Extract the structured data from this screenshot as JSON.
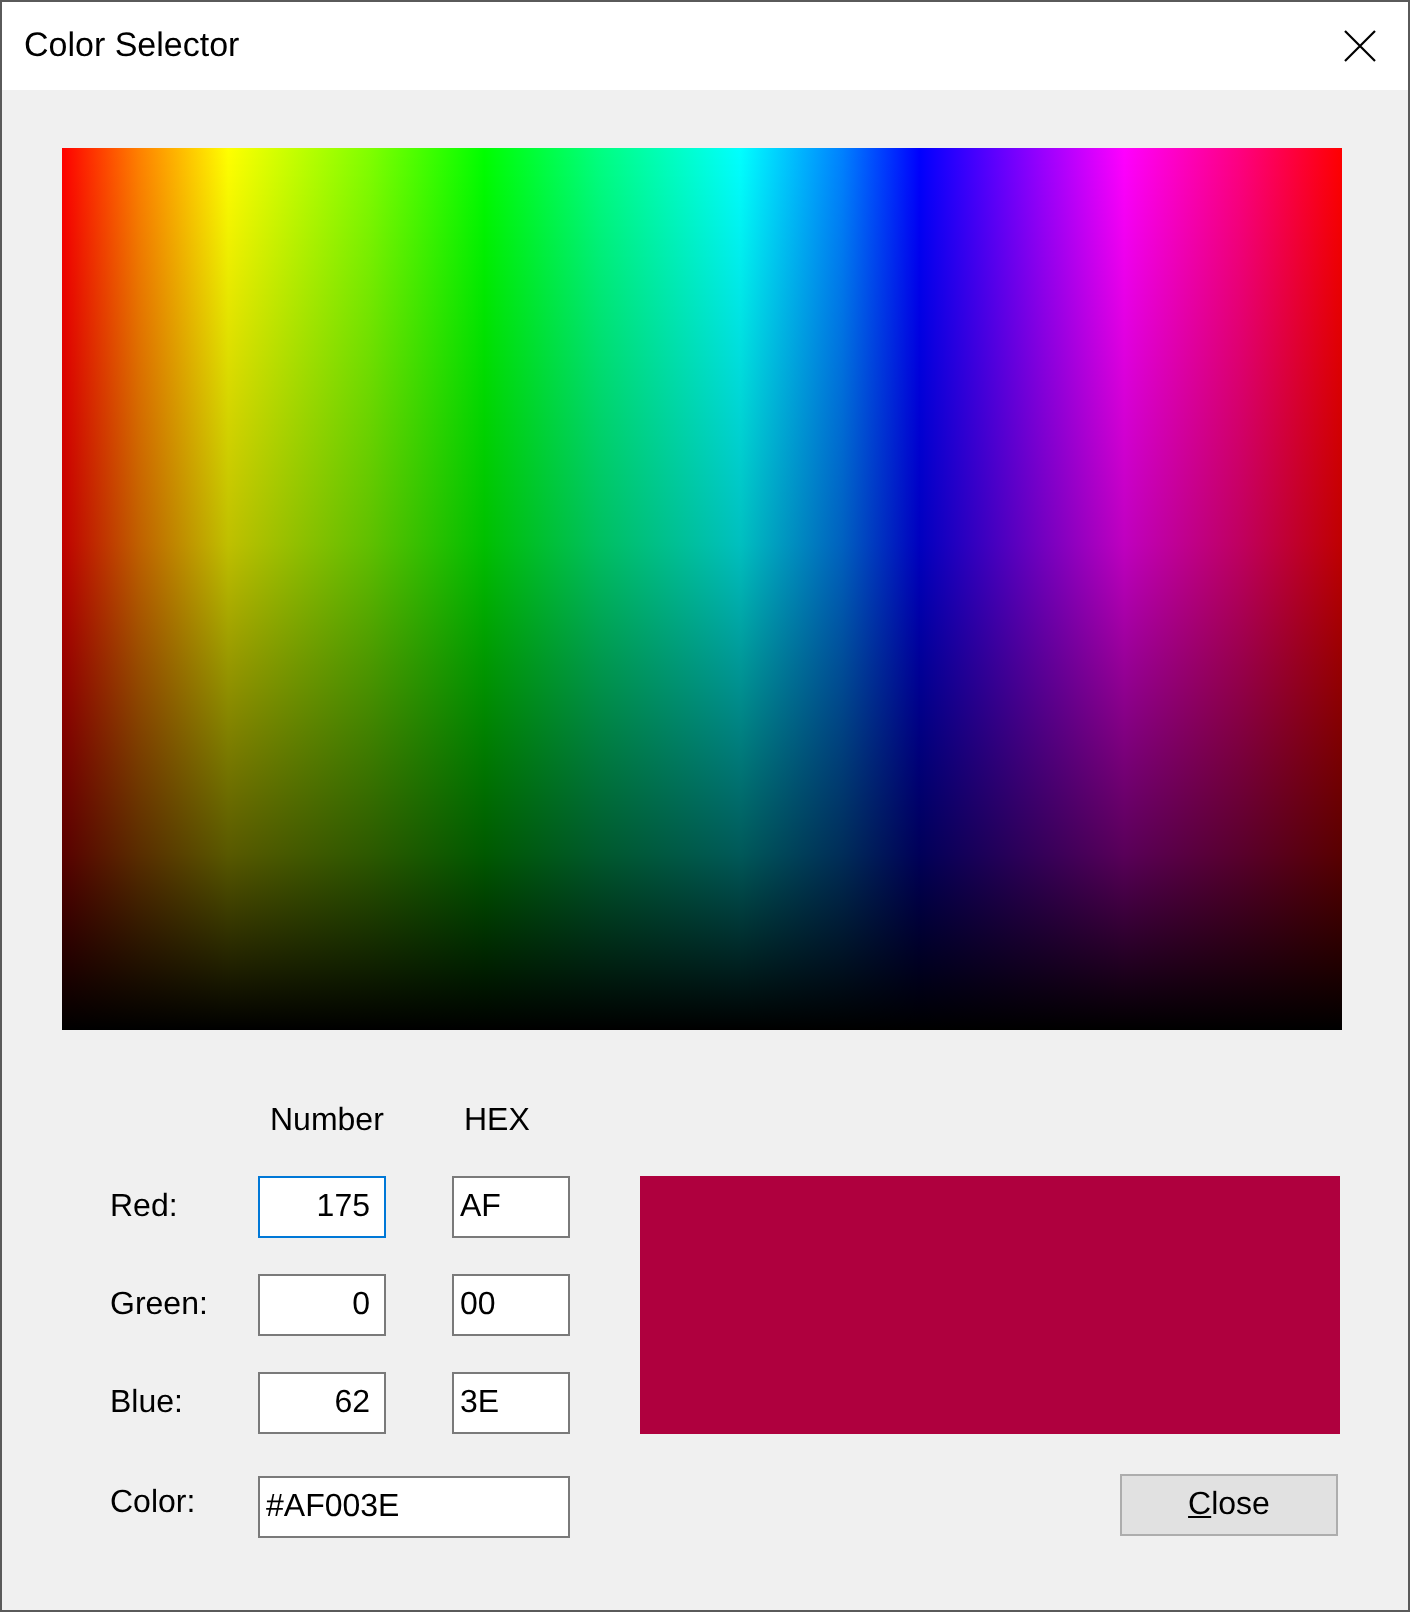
{
  "window": {
    "title": "Color Selector"
  },
  "columns": [
    "Number",
    "HEX"
  ],
  "channels": [
    {
      "label": "Red:",
      "number": "175",
      "hex": "AF",
      "focused": true
    },
    {
      "label": "Green:",
      "number": "0",
      "hex": "00",
      "focused": false
    },
    {
      "label": "Blue:",
      "number": "62",
      "hex": "3E",
      "focused": false
    }
  ],
  "color_field": {
    "label": "Color:",
    "value": "#AF003E"
  },
  "preview": {
    "color": "#af003e"
  },
  "close_button": {
    "label": "Close",
    "mnemonic": true
  }
}
